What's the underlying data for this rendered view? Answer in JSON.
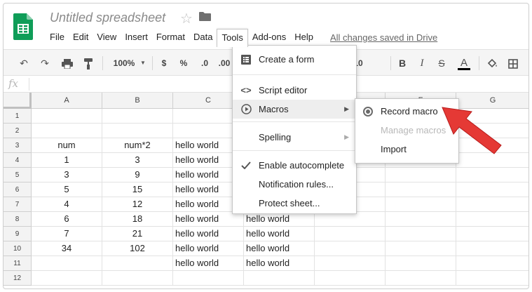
{
  "app": {
    "title": "Untitled spreadsheet",
    "star_icon": "star-icon",
    "folder_icon": "folder-icon",
    "save_status": "All changes saved in Drive",
    "accent_color": "#0f9d58"
  },
  "menubar": [
    "File",
    "Edit",
    "View",
    "Insert",
    "Format",
    "Data",
    "Tools",
    "Add-ons",
    "Help"
  ],
  "toolbar": {
    "zoom": "100%",
    "currency": "$",
    "percent": "%",
    "decrease_decimals": ".0",
    "increase_decimals": ".00",
    "font_size": "10",
    "bold": "B",
    "italic": "I",
    "strikethrough": "S",
    "text_color": "A"
  },
  "formula_bar": {
    "fx": "fx",
    "value": ""
  },
  "columns": [
    "A",
    "B",
    "C",
    "D",
    "E",
    "F",
    "G"
  ],
  "rows": [
    "1",
    "2",
    "3",
    "4",
    "5",
    "6",
    "7",
    "8",
    "9",
    "10",
    "11",
    "12"
  ],
  "cells": {
    "A": [
      "",
      "",
      "num",
      "1",
      "3",
      "5",
      "4",
      "6",
      "7",
      "34",
      "",
      ""
    ],
    "B": [
      "",
      "",
      "num*2",
      "3",
      "9",
      "15",
      "12",
      "18",
      "21",
      "102",
      "",
      ""
    ],
    "C": [
      "",
      "",
      "hello world",
      "hello world",
      "hello world",
      "hello world",
      "hello world",
      "hello world",
      "hello world",
      "hello world",
      "hello world",
      ""
    ],
    "D": [
      "",
      "",
      "",
      "",
      "",
      "",
      "",
      "hello world",
      "hello world",
      "hello world",
      "hello world",
      ""
    ]
  },
  "tools_menu": {
    "items": [
      {
        "label": "Create a form",
        "icon": "form-icon"
      },
      {
        "label": "Script editor",
        "icon": "code-icon"
      },
      {
        "label": "Macros",
        "icon": "play-circle-icon",
        "submenu": true
      },
      {
        "label": "Spelling",
        "submenu": true
      },
      {
        "label": "Enable autocomplete",
        "icon": "check-icon"
      },
      {
        "label": "Notification rules..."
      },
      {
        "label": "Protect sheet..."
      }
    ]
  },
  "macros_submenu": {
    "items": [
      {
        "label": "Record macro",
        "icon": "radio-icon"
      },
      {
        "label": "Manage macros",
        "disabled": true
      },
      {
        "label": "Import"
      }
    ]
  },
  "annotation": {
    "icon": "red-pointer-arrow-icon",
    "color": "#e53935"
  }
}
